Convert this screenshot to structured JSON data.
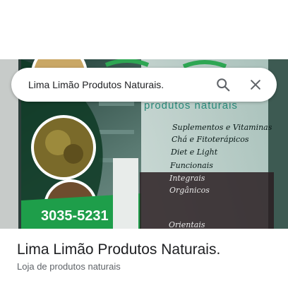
{
  "search": {
    "query": "Lima Limão Produtos Naturais."
  },
  "icons": {
    "search": "search-icon",
    "close": "close-icon"
  },
  "photo": {
    "store_subtitle": "produtos naturais",
    "products": [
      "Suplementos e Vitaminas",
      "Chá e Fitoterápicos",
      "Diet e Light",
      "Funcionais",
      "Integrais",
      "Orgânicos"
    ],
    "bottom_word": "Orientais",
    "phone": "3035-5231"
  },
  "place": {
    "name": "Lima Limão Produtos Naturais.",
    "category": "Loja de produtos naturais"
  },
  "colors": {
    "accent_green": "#1e9e4a",
    "dark_glass": "#0f2a25"
  }
}
